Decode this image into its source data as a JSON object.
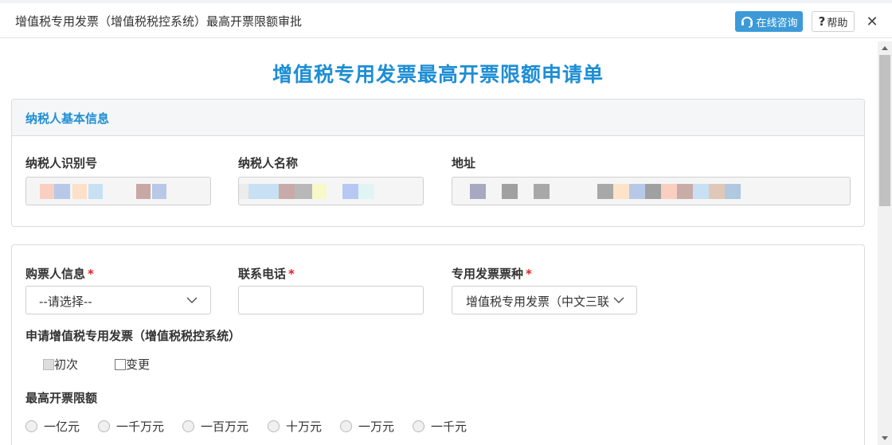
{
  "window": {
    "title": "增值税专用发票（增值税税控系统）最高开票限额审批",
    "consult_label": "在线咨询",
    "help_label": "帮助",
    "close_glyph": "✕"
  },
  "form": {
    "title": "增值税专用发票最高开票限额申请单"
  },
  "taxpayer_panel": {
    "heading": "纳税人基本信息",
    "tax_id_label": "纳税人识别号",
    "name_label": "纳税人名称",
    "address_label": "地址"
  },
  "application_panel": {
    "buyer_label": "购票人信息",
    "buyer_value": "--请选择--",
    "phone_label": "联系电话",
    "phone_value": "",
    "invoice_type_label": "专用发票票种",
    "invoice_type_value": "增值税专用发票（中文三联",
    "apply_label": "申请增值税专用发票（增值税税控系统）",
    "apply_options": [
      "初次",
      "变更"
    ],
    "limit_label": "最高开票限额",
    "limit_options": [
      "一亿元",
      "一千万元",
      "一百万元",
      "十万元",
      "一万元",
      "一千元"
    ]
  },
  "colors": {
    "accent": "#1e8ed4",
    "consult_button": "#3c9ad8",
    "required": "#e02020"
  }
}
